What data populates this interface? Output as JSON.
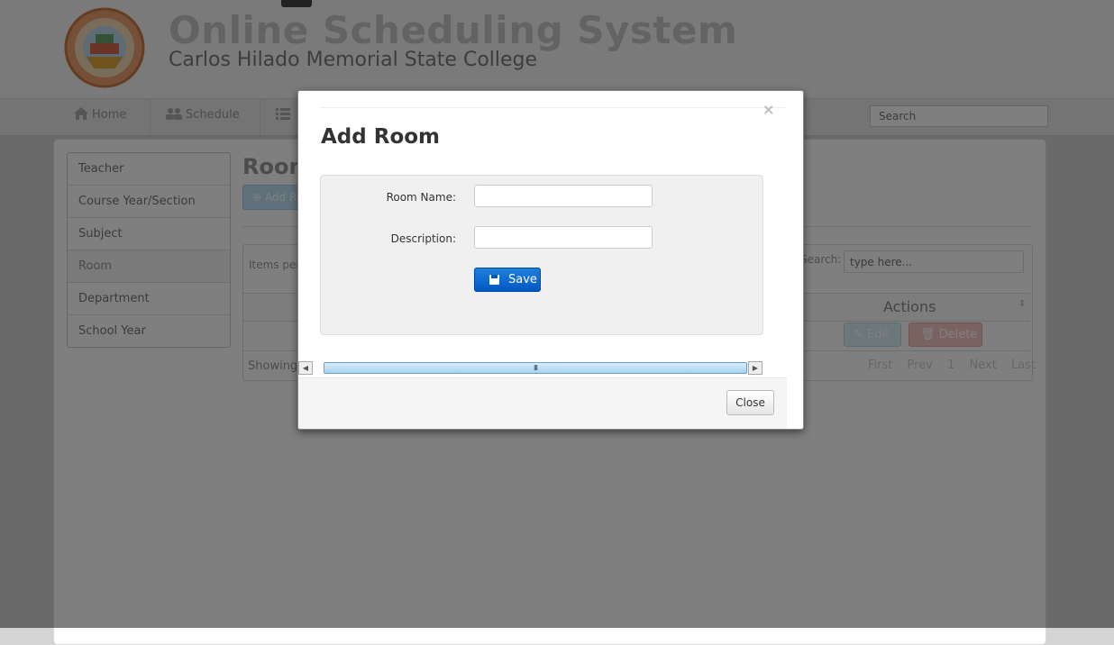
{
  "header": {
    "title": "Online Scheduling System",
    "subtitle": "Carlos Hilado Memorial State College"
  },
  "navbar": {
    "items": [
      {
        "label": "Home",
        "icon": "home-icon"
      },
      {
        "label": "Schedule",
        "icon": "users-icon"
      },
      {
        "label": "",
        "icon": "list-icon"
      }
    ],
    "search_placeholder": "Search"
  },
  "sidebar": {
    "items": [
      {
        "label": "Teacher"
      },
      {
        "label": "Course Year/Section"
      },
      {
        "label": "Subject"
      },
      {
        "label": "Room",
        "active": true
      },
      {
        "label": "Department"
      },
      {
        "label": "School Year"
      }
    ]
  },
  "main": {
    "title": "Room",
    "add_button_label": "Add R",
    "items_per_page_label": "Items per",
    "search_label": "Search:",
    "search_placeholder": "type here...",
    "actions_header": "Actions",
    "edit_label": "Edit",
    "delete_label": "Delete",
    "showing_label": "Showing",
    "pager": [
      "First",
      "Prev",
      "1",
      "Next",
      "Last"
    ]
  },
  "modal": {
    "close_x": "×",
    "title": "Add Room",
    "room_name_label": "Room Name:",
    "room_name_value": "",
    "description_label": "Description:",
    "description_value": "",
    "save_label": "Save",
    "scroll_left": "◀",
    "scroll_right": "▶",
    "scroll_grip": "III",
    "close_label": "Close"
  },
  "colors": {
    "primary_button": "#0058c4",
    "edit_button": "#5bc0de",
    "delete_button": "#d9534f"
  }
}
